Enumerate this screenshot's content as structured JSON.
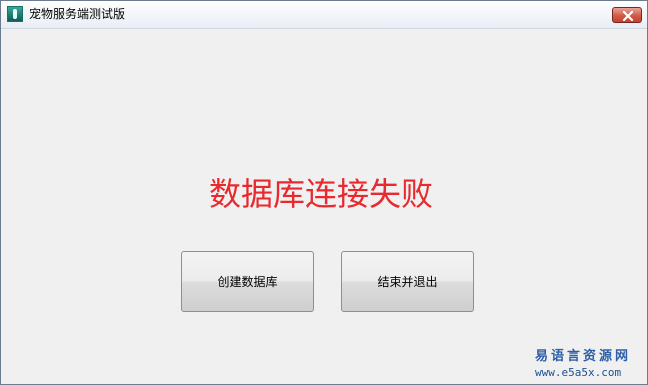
{
  "window": {
    "title": "宠物服务端测试版",
    "icon": "app-icon",
    "close_icon": "close-icon"
  },
  "main": {
    "message": "数据库连接失败",
    "message_color": "#e8292d"
  },
  "buttons": {
    "create_db_label": "创建数据库",
    "exit_label": "结束并退出"
  },
  "watermark": {
    "title": "易语言资源网",
    "url": "www.e5a5x.com"
  }
}
